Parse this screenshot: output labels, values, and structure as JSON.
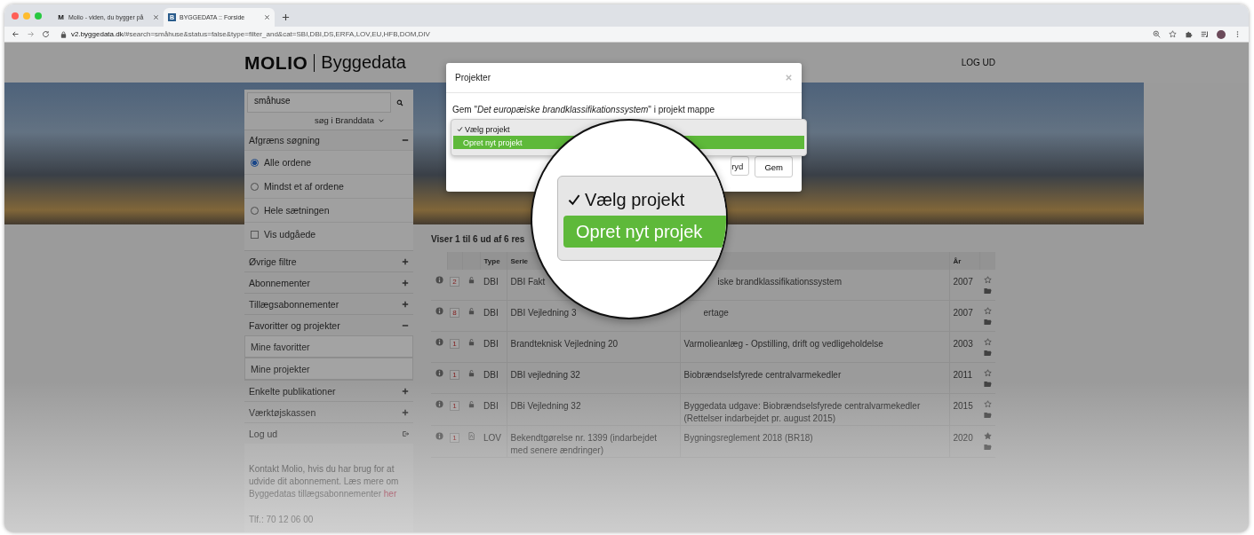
{
  "browser": {
    "tabs": [
      {
        "title": "Molio - viden, du bygger på",
        "favicon": "M",
        "selected": false
      },
      {
        "title": "BYGGEDATA :: Forside",
        "favicon": "B",
        "selected": true
      }
    ],
    "url_host": "v2.byggedata.dk",
    "url_path": "/#search=småhuse&status=false&type=filter_and&cat=SBI,DBI,DS,ERFA,LOV,EU,HFB,DOM,DIV"
  },
  "header": {
    "brand": "MOLIO",
    "product": "Byggedata",
    "logout": "LOG UD"
  },
  "sidebar": {
    "search": {
      "value": "småhuse"
    },
    "scope": "søg i Branddata",
    "filter": {
      "title": "Afgræns søgning",
      "expanded": true,
      "match_options": [
        {
          "label": "Alle ordene",
          "selected": true
        },
        {
          "label": "Mindst et af ordene",
          "selected": false
        },
        {
          "label": "Hele sætningen",
          "selected": false
        }
      ],
      "show_expired": {
        "label": "Vis udgåede",
        "checked": false
      }
    },
    "sections": [
      {
        "label": "Øvrige filtre",
        "kind": "toggle",
        "expanded": false
      },
      {
        "label": "Abonnementer",
        "kind": "toggle",
        "expanded": false
      },
      {
        "label": "Tillægsabonnementer",
        "kind": "toggle",
        "expanded": false
      },
      {
        "label": "Favoritter og projekter",
        "kind": "toggle",
        "expanded": true,
        "children": [
          {
            "label": "Mine favoritter"
          },
          {
            "label": "Mine projekter"
          }
        ]
      },
      {
        "label": "Enkelte publikationer",
        "kind": "toggle",
        "expanded": false
      },
      {
        "label": "Værktøjskassen",
        "kind": "toggle",
        "expanded": false
      },
      {
        "label": "Log ud",
        "kind": "logout"
      }
    ],
    "info": {
      "text": "Kontakt Molio, hvis du har brug for at udvide dit abonnement. Læs mere om Byggedatas tillægsabonnementer",
      "link": "her"
    },
    "phone": "Tlf.: 70 12 06 00"
  },
  "results": {
    "summary": "Viser 1 til 6 ud af 6 res",
    "columns": {
      "type": "Type",
      "series": "Serie",
      "year": "År"
    },
    "rows": [
      {
        "count": "2",
        "kind": "lock",
        "type": "DBI",
        "series": "DBI Fakt",
        "title": "iske brandklassifikationssystem",
        "year": "2007",
        "favorite": false
      },
      {
        "count": "8",
        "kind": "lock",
        "type": "DBI",
        "series": "DBI Vejledning 3",
        "title": "ertage",
        "year": "2007",
        "favorite": false
      },
      {
        "count": "1",
        "kind": "lock",
        "type": "DBI",
        "series": "Brandteknisk Vejledning 20",
        "title": "Varmolieanlæg - Opstilling, drift og vedligeholdelse",
        "year": "2003",
        "favorite": false
      },
      {
        "count": "1",
        "kind": "lock",
        "type": "DBI",
        "series": "DBI vejledning 32",
        "title": "Biobrændselsfyrede centralvarmekedler",
        "year": "2011",
        "favorite": false
      },
      {
        "count": "1",
        "kind": "lock",
        "type": "DBI",
        "series": "DBi Vejledning 32",
        "title": "Byggedata udgave: Biobrændselsfyrede centralvarmekedler (Rettelser indarbejdet pr. august 2015)",
        "year": "2015",
        "favorite": false
      },
      {
        "count": "1",
        "kind": "pdf",
        "type": "LOV",
        "series": "Bekendtgørelse nr. 1399 (indarbejdet med senere ændringer)",
        "title": "Bygningsreglement 2018 (BR18)",
        "year": "2020",
        "favorite": true
      }
    ]
  },
  "modal": {
    "title": "Projekter",
    "message": "Gem \"*Det europæiske brandklassifikationssystem*\" i projekt mappe",
    "options": [
      {
        "label": "Vælg projekt",
        "checked": true,
        "highlighted": false
      },
      {
        "label": "Opret nyt projekt",
        "checked": false,
        "highlighted": true
      }
    ],
    "buttons": [
      "ryd",
      "Gem"
    ]
  },
  "magnifier": {
    "options": [
      {
        "label": "Vælg projekt",
        "checked": true,
        "highlighted": false
      },
      {
        "label": "Opret nyt projek",
        "checked": false,
        "highlighted": true
      }
    ]
  }
}
